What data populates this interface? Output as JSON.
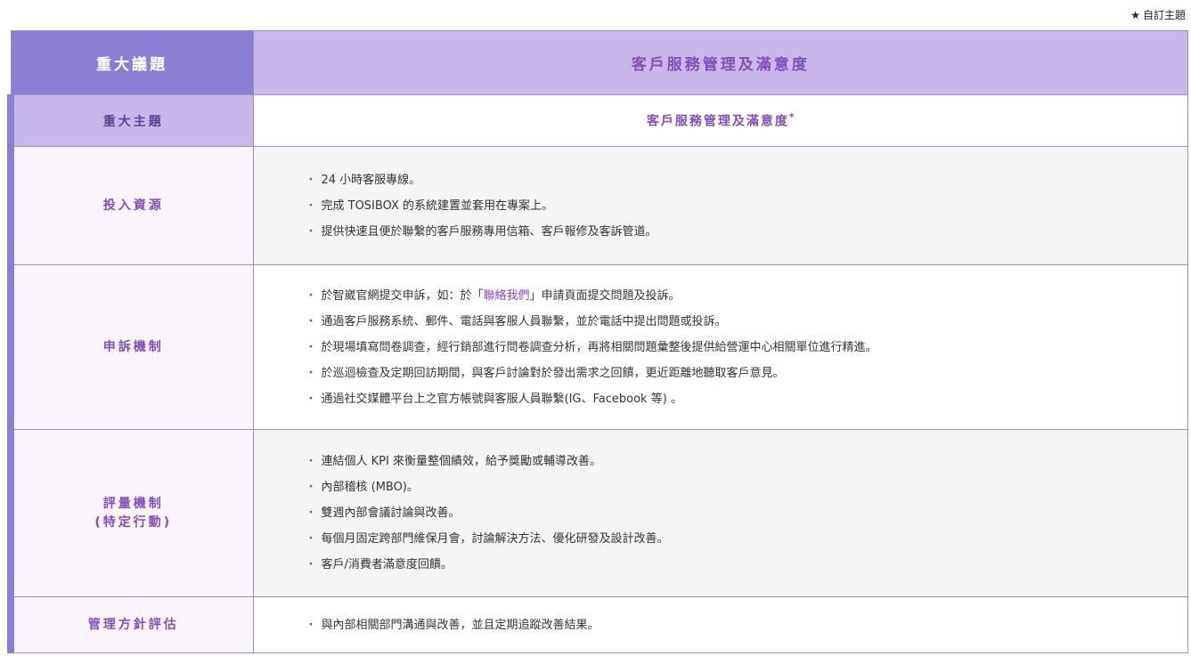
{
  "top_note": {
    "icon": "star-icon",
    "star": "★",
    "label": "自訂主題"
  },
  "header": {
    "left": "重大議題",
    "right": "客戶服務管理及滿意度"
  },
  "subheader": {
    "left": "重大主題",
    "right": "客戶服務管理及滿意度",
    "marker": "*"
  },
  "rows": {
    "inputs": {
      "label": "投入資源",
      "items": [
        "24 小時客服專線。",
        "完成 TOSIBOX 的系統建置並套用在專案上。",
        "提供快速且便於聯繫的客戶服務專用信箱、客戶報修及客訴管道。"
      ]
    },
    "complaint": {
      "label": "申訴機制",
      "item1_pre": "於智崴官網提交申訴，如：於「",
      "item1_link": "聯絡我們",
      "item1_post": "」申請頁面提交問題及投訴。",
      "items": [
        "通過客戶服務系統、郵件、電話與客服人員聯繫，並於電話中提出問題或投訴。",
        "於現場填寫問卷調查，經行銷部進行問卷調查分析，再將相關問題彙整後提供給營運中心相關單位進行精進。",
        "於巡迴檢查及定期回訪期間，與客戶討論對於發出需求之回饋，更近距離地聽取客戶意見。",
        "通過社交媒體平台上之官方帳號與客服人員聯繫(IG、Facebook 等) 。"
      ]
    },
    "evaluation": {
      "label_line1": "評量機制",
      "label_line2": "(特定行動)",
      "items": [
        "連結個人 KPI 來衡量整個績效，給予獎勵或輔導改善。",
        "內部稽核 (MBO)。",
        "雙週內部會議討論與改善。",
        "每個月固定跨部門維保月會，討論解決方法、優化研發及設計改善。",
        "客戶/消費者滿意度回饋。"
      ]
    },
    "management": {
      "label": "管理方針評估",
      "items": [
        "與內部相關部門溝通與改善，並且定期追蹤改善結果。"
      ]
    }
  },
  "bullet": "・",
  "colors": {
    "header_left_bg": "#8a7fd4",
    "header_right_bg": "#c8b8ea",
    "accent_text": "#8050b8",
    "link": "#8a3fc0",
    "border": "#9a8cd4"
  }
}
